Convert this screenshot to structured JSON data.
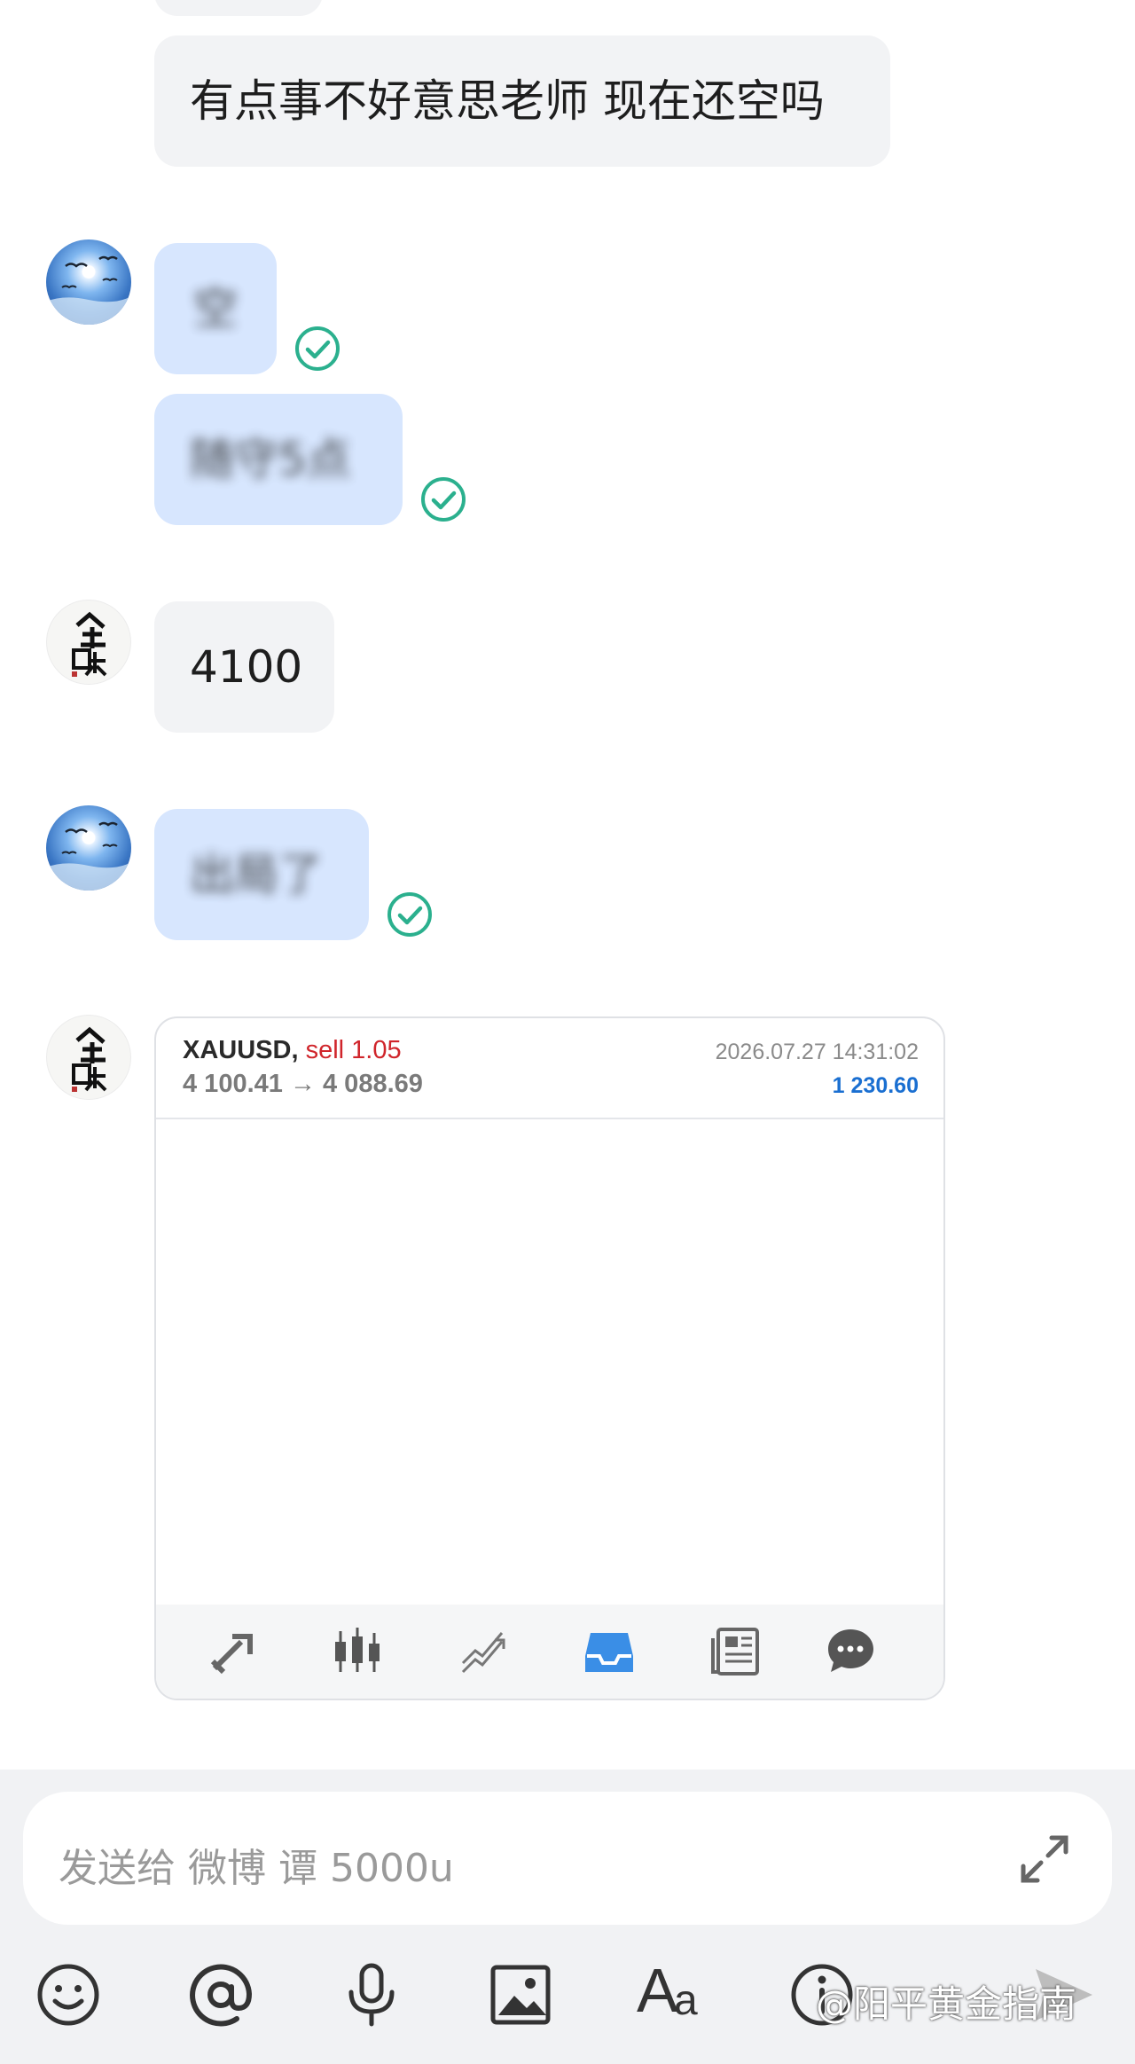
{
  "messages": [
    {
      "side": "gray",
      "text": "有点事不好意思老师 现在还空吗"
    },
    {
      "side": "blue",
      "text": "空",
      "status": "check-circle-icon"
    },
    {
      "side": "blue",
      "text": "随守5点",
      "status": "check-circle-icon"
    },
    {
      "side": "gray",
      "text": "4100"
    },
    {
      "side": "blue",
      "text": "出局了",
      "status": "check-circle-icon"
    }
  ],
  "trade_card": {
    "symbol": "XAUUSD,",
    "action": "sell 1.05",
    "prices": "4 100.41 → 4 088.69",
    "datetime": "2026.07.27 14:31:02",
    "profit": "1 230.60",
    "toolbar_icons": [
      "trade-icon",
      "candlestick-icon",
      "chart-trend-icon",
      "inbox-icon",
      "news-icon",
      "chat-icon"
    ],
    "active_icon": "inbox-icon"
  },
  "composer": {
    "placeholder": "发送给 微博 谭 5000u",
    "expand_icon": "expand-icon"
  },
  "bottom_bar": [
    "emoji-icon",
    "at-icon",
    "microphone-icon",
    "image-icon",
    "text-format-icon",
    "info-icon",
    "send-icon"
  ],
  "watermark": "@阳平黄金指南",
  "colors": {
    "sent_bubble": "#d7e6fe",
    "received_bubble": "#f2f3f5",
    "check": "#2bb08e",
    "sell": "#d0252b",
    "profit": "#1a6fd1",
    "inbox_active": "#3a8ee6"
  }
}
